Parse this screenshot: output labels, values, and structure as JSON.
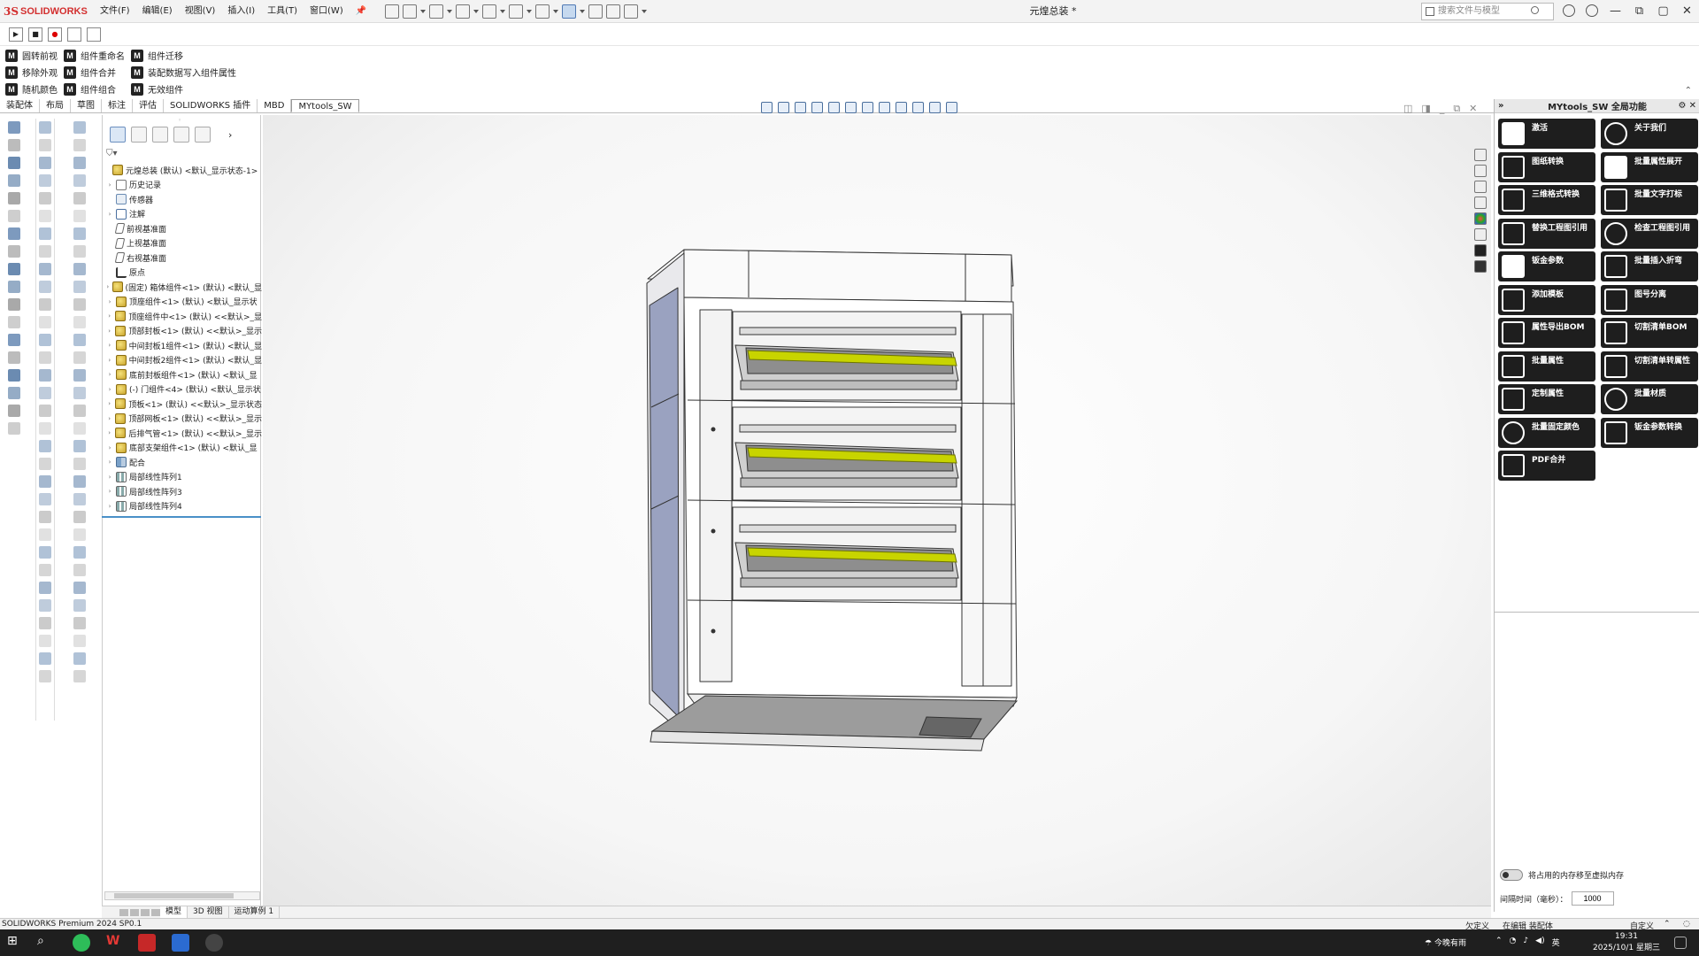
{
  "app": {
    "logo_ds": "3S",
    "logo_text": "SOLIDWORKS",
    "window_title": "元煌总装 *",
    "menu": [
      "文件(F)",
      "编辑(E)",
      "视图(V)",
      "插入(I)",
      "工具(T)",
      "窗口(W)"
    ],
    "search_placeholder": "搜索文件与模型",
    "win_controls": [
      "—",
      "▢",
      "✕"
    ]
  },
  "commands": {
    "col1": [
      "圆转前视",
      "移除外观",
      "随机颜色"
    ],
    "col2": [
      "组件重命名",
      "组件合并",
      "组件组合"
    ],
    "col3": [
      "组件迁移",
      "装配数据写入组件属性",
      "无效组件"
    ],
    "macro_letter": "M"
  },
  "tabs": [
    "装配体",
    "布局",
    "草图",
    "标注",
    "评估",
    "SOLIDWORKS 插件",
    "MBD",
    "MYtools_SW"
  ],
  "active_tab": 7,
  "tree": [
    {
      "exp": "",
      "icon": "asm",
      "label": "元煌总装 (默认) <默认_显示状态-1>",
      "indent": 0
    },
    {
      "exp": "›",
      "icon": "hist",
      "label": "历史记录",
      "indent": 1
    },
    {
      "exp": "",
      "icon": "sens",
      "label": "传感器",
      "indent": 1
    },
    {
      "exp": "›",
      "icon": "ann",
      "label": "注解",
      "indent": 1
    },
    {
      "exp": "",
      "icon": "plane",
      "label": "前视基准面",
      "indent": 1
    },
    {
      "exp": "",
      "icon": "plane",
      "label": "上视基准面",
      "indent": 1
    },
    {
      "exp": "",
      "icon": "plane",
      "label": "右视基准面",
      "indent": 1
    },
    {
      "exp": "",
      "icon": "origin",
      "label": "原点",
      "indent": 1
    },
    {
      "exp": "›",
      "icon": "asm",
      "label": "(固定) 箱体组件<1> (默认) <默认_显",
      "indent": 1
    },
    {
      "exp": "›",
      "icon": "asm",
      "label": "顶座组件<1> (默认) <默认_显示状",
      "indent": 1
    },
    {
      "exp": "›",
      "icon": "asm",
      "label": "顶座组件中<1> (默认) <<默认>_显",
      "indent": 1
    },
    {
      "exp": "›",
      "icon": "asm",
      "label": "顶部封板<1> (默认) <<默认>_显示",
      "indent": 1
    },
    {
      "exp": "›",
      "icon": "asm",
      "label": "中间封板1组件<1> (默认) <默认_显",
      "indent": 1
    },
    {
      "exp": "›",
      "icon": "asm",
      "label": "中间封板2组件<1> (默认) <默认_显",
      "indent": 1
    },
    {
      "exp": "›",
      "icon": "asm",
      "label": "底前封板组件<1> (默认) <默认_显",
      "indent": 1
    },
    {
      "exp": "›",
      "icon": "asm",
      "label": "(-) 门组件<4> (默认) <默认_显示状",
      "indent": 1
    },
    {
      "exp": "›",
      "icon": "asm",
      "label": "顶板<1> (默认) <<默认>_显示状态",
      "indent": 1
    },
    {
      "exp": "›",
      "icon": "asm",
      "label": "顶部网板<1> (默认) <<默认>_显示",
      "indent": 1
    },
    {
      "exp": "›",
      "icon": "asm",
      "label": "后排气管<1> (默认) <<默认>_显示",
      "indent": 1
    },
    {
      "exp": "›",
      "icon": "asm",
      "label": "底部支架组件<1> (默认) <默认_显",
      "indent": 1
    },
    {
      "exp": "›",
      "icon": "mate",
      "label": "配合",
      "indent": 1
    },
    {
      "exp": "›",
      "icon": "pat",
      "label": "局部线性阵列1",
      "indent": 1
    },
    {
      "exp": "›",
      "icon": "pat",
      "label": "局部线性阵列3",
      "indent": 1
    },
    {
      "exp": "›",
      "icon": "pat",
      "label": "局部线性阵列4",
      "indent": 1
    }
  ],
  "taskpane": {
    "title": "MYtools_SW 全局功能",
    "tools": [
      {
        "label": "激活",
        "icon": "fill"
      },
      {
        "label": "关于我们",
        "icon": "round"
      },
      {
        "label": "图纸转换",
        "icon": "box"
      },
      {
        "label": "批量属性展开",
        "icon": "fill"
      },
      {
        "label": "三维格式转换",
        "icon": "box"
      },
      {
        "label": "批量文字打标",
        "icon": "box"
      },
      {
        "label": "替换工程图引用",
        "icon": "box"
      },
      {
        "label": "检查工程图引用",
        "icon": "round"
      },
      {
        "label": "钣金参数",
        "icon": "fill"
      },
      {
        "label": "批量插入折弯",
        "icon": "box"
      },
      {
        "label": "添加模板",
        "icon": "box"
      },
      {
        "label": "图号分离",
        "icon": "box"
      },
      {
        "label": "属性导出BOM",
        "icon": "box"
      },
      {
        "label": "切割清单BOM",
        "icon": "box"
      },
      {
        "label": "批量属性",
        "icon": "box"
      },
      {
        "label": "切割清单转属性",
        "icon": "box"
      },
      {
        "label": "定制属性",
        "icon": "box"
      },
      {
        "label": "批量材质",
        "icon": "round"
      },
      {
        "label": "批量固定颜色",
        "icon": "round"
      },
      {
        "label": "钣金参数转换",
        "icon": "box"
      },
      {
        "label": "PDF合并",
        "icon": "box"
      }
    ],
    "toggle_label": "将占用的内存移至虚拟内存",
    "interval_label": "间隔时间（毫秒）：",
    "interval_value": "1000"
  },
  "bottom_tabs": [
    "模型",
    "3D 视图",
    "运动算例 1"
  ],
  "active_bottom_tab": 0,
  "status": {
    "version": "SOLIDWORKS Premium 2024 SP0.1",
    "state1": "欠定义",
    "state2": "在编辑 装配体",
    "custom": "自定义"
  },
  "taskbar": {
    "weather": "今晚有雨",
    "ime": "英",
    "time": "19:31",
    "date": "2025/10/1 星期三"
  },
  "colors": {
    "brand_red": "#d32f2f",
    "tool_bg": "#1e1e1e",
    "rail_yellow": "#c8d400",
    "panel_blue": "#9aa2c0"
  }
}
